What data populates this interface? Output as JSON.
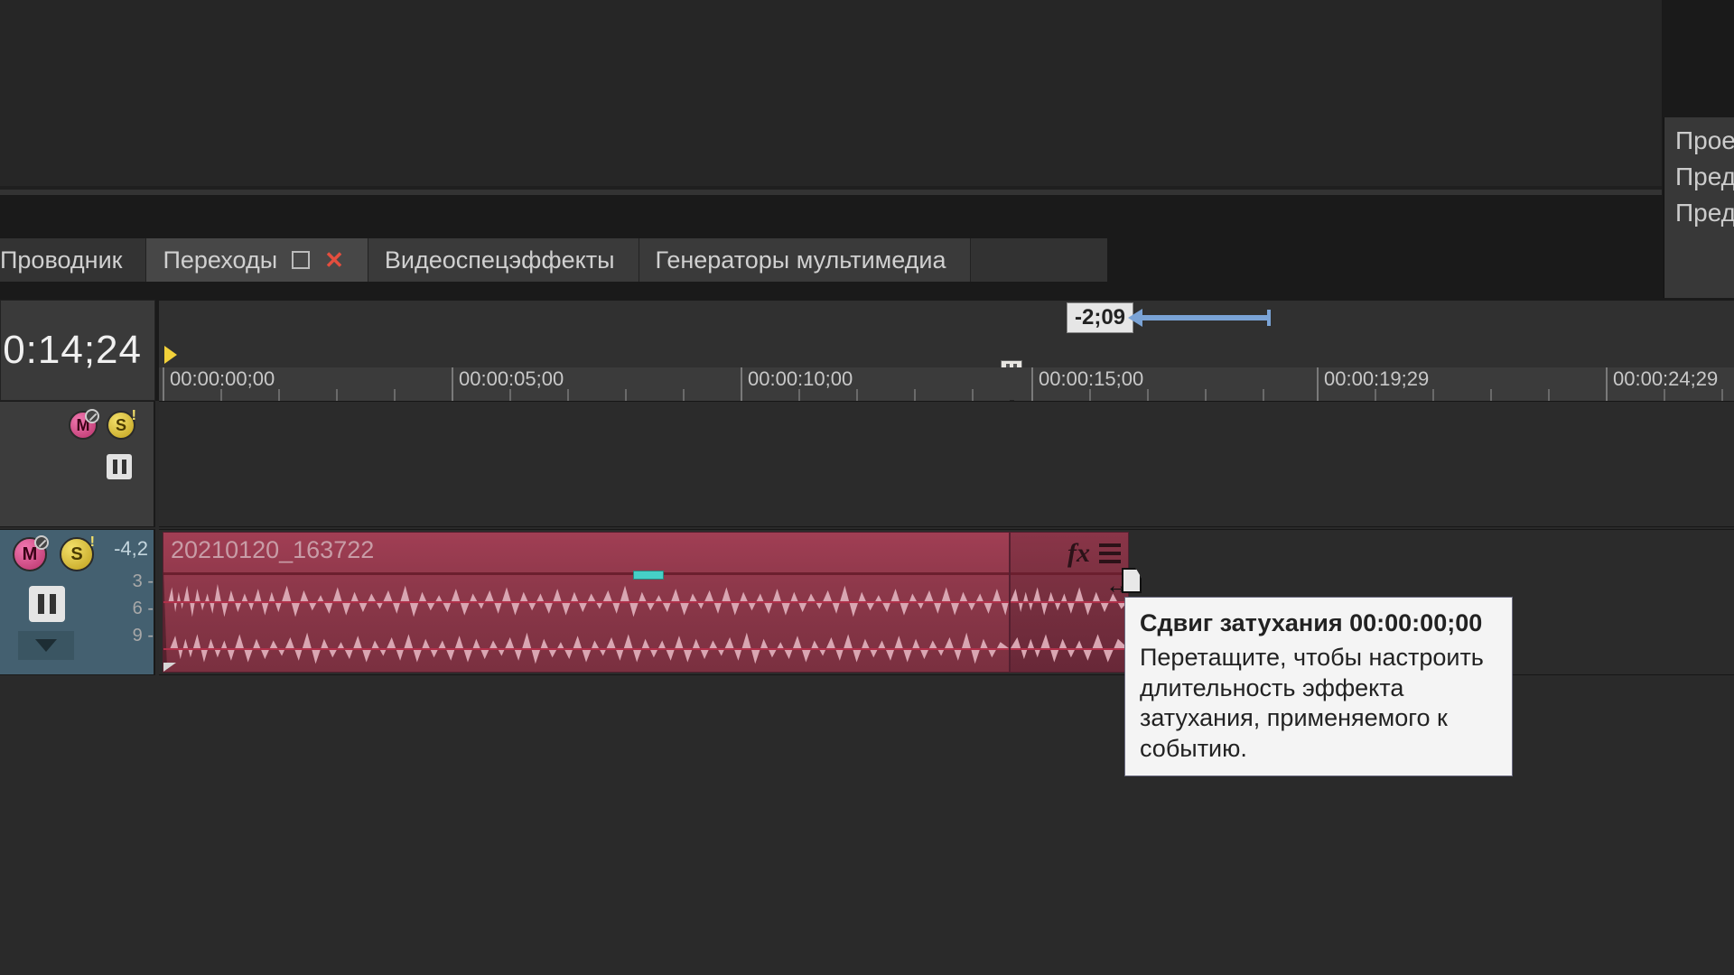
{
  "tabs": {
    "explorer": "Проводник",
    "transitions": "Переходы",
    "videofx": "Видеоспецэффекты",
    "generators": "Генераторы мультимедиа"
  },
  "right_panel": {
    "l1": "Прое",
    "l2": "Пред",
    "l3": "Пред"
  },
  "time": {
    "current": "0:14;24",
    "offset": "-2;09"
  },
  "ruler": {
    "t0": "00:00:00;00",
    "t1": "00:00:05;00",
    "t2": "00:00:10;00",
    "t3": "00:00:15;00",
    "t4": "00:00:19;29",
    "t5": "00:00:24;29"
  },
  "audio_track": {
    "db_label": "-4,2",
    "scale": {
      "v3": "3 -",
      "v6": "6 -",
      "v9": "9 -"
    }
  },
  "clip": {
    "name": "20210120_163722"
  },
  "tooltip": {
    "title_prefix": "Сдвиг затухания",
    "title_time": "00:00:00;00",
    "body": "Перетащите, чтобы настроить длительность эффекта затухания, применяемого к событию."
  }
}
